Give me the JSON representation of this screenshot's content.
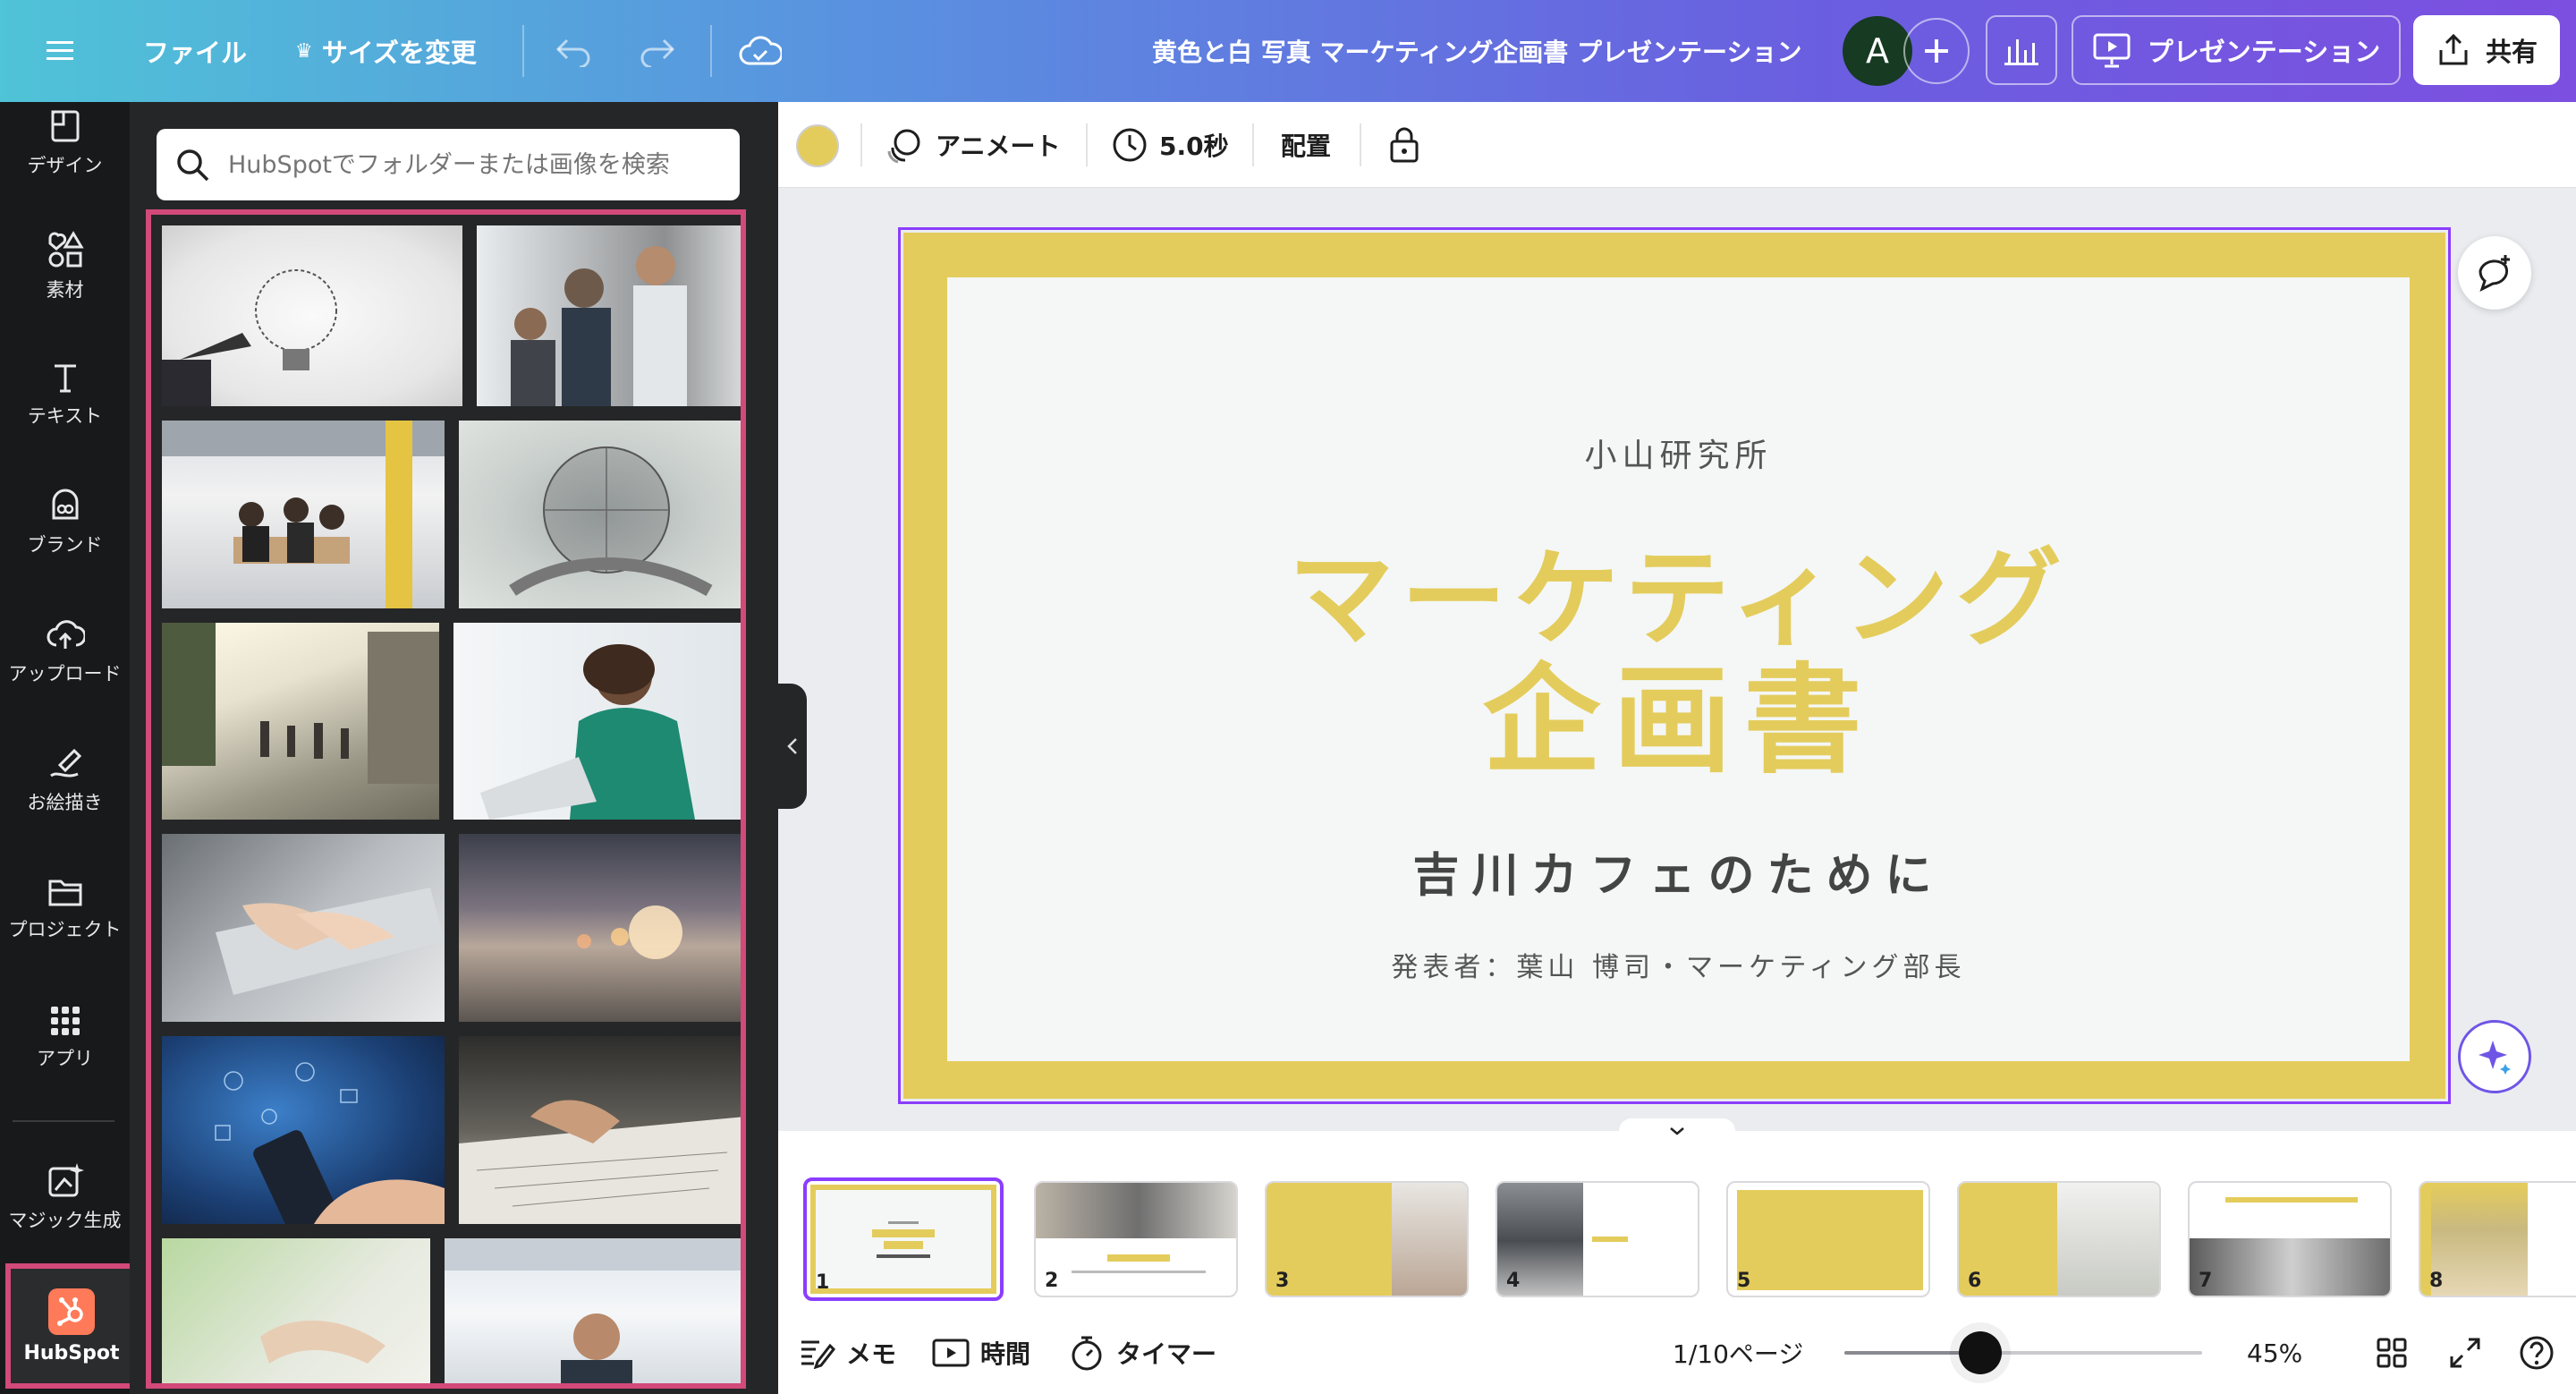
{
  "topbar": {
    "file_label": "ファイル",
    "resize_label": "サイズを変更",
    "doc_title": "黄色と白 写真 マーケティング企画書 プレゼンテーション",
    "avatar_letter": "A",
    "present_label": "プレゼンテーション",
    "share_label": "共有"
  },
  "sidebar": {
    "items": [
      {
        "label": "デザイン",
        "icon": "design-icon"
      },
      {
        "label": "素材",
        "icon": "elements-icon"
      },
      {
        "label": "テキスト",
        "icon": "text-icon"
      },
      {
        "label": "ブランド",
        "icon": "brand-icon"
      },
      {
        "label": "アップロード",
        "icon": "upload-icon"
      },
      {
        "label": "お絵描き",
        "icon": "draw-icon"
      },
      {
        "label": "プロジェクト",
        "icon": "folder-icon"
      },
      {
        "label": "アプリ",
        "icon": "apps-icon"
      },
      {
        "label": "マジック生成",
        "icon": "magic-icon"
      },
      {
        "label": "HubSpot",
        "icon": "hubspot-icon"
      }
    ]
  },
  "panel": {
    "search_placeholder": "HubSpotでフォルダーまたは画像を検索"
  },
  "toolbar": {
    "animate_label": "アニメート",
    "duration_label": "5.0秒",
    "arrange_label": "配置",
    "color_swatch": "#e4cc5c"
  },
  "slide": {
    "org": "小山研究所",
    "title_line1": "マーケティング",
    "title_line2": "企画書",
    "subtitle": "吉川カフェのために",
    "presenter": "発表者：葉山 博司・マーケティング部長"
  },
  "thumbnails": [
    "1",
    "2",
    "3",
    "4",
    "5",
    "6",
    "7",
    "8"
  ],
  "bottombar": {
    "notes_label": "メモ",
    "time_label": "時間",
    "timer_label": "タイマー",
    "page_indicator": "1/10ページ",
    "zoom_label": "45%",
    "zoom_fraction": 0.38
  },
  "colors": {
    "accent": "#8b3dff",
    "slide_yellow": "#e4cc5c",
    "selection_pink": "#d2497a",
    "hubspot_orange": "#ff7a59"
  }
}
